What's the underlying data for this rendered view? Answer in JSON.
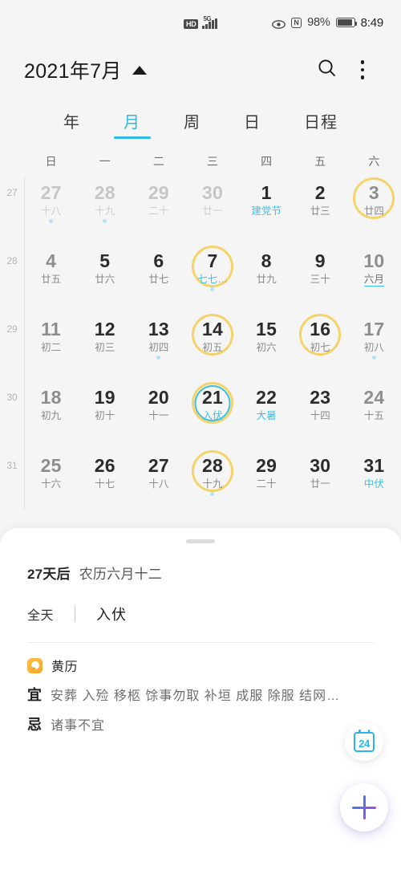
{
  "status_bar": {
    "hd_label": "HD",
    "network_label": "5G",
    "signal_icon": "signal-bars-icon",
    "eye_icon": "eye-icon",
    "nfc_label": "N",
    "battery_percent": "98%",
    "battery_icon": "battery-icon",
    "time": "8:49"
  },
  "header": {
    "title": "2021年7月",
    "caret_icon": "triangle-up-icon",
    "search_icon": "search-icon",
    "overflow_icon": "more-vertical-icon"
  },
  "view_tabs": [
    {
      "label": "年",
      "active": false
    },
    {
      "label": "月",
      "active": true
    },
    {
      "label": "周",
      "active": false
    },
    {
      "label": "日",
      "active": false
    },
    {
      "label": "日程",
      "active": false
    }
  ],
  "weekday_headers": [
    "日",
    "一",
    "二",
    "三",
    "四",
    "五",
    "六"
  ],
  "weeks": [
    {
      "number": "27",
      "days": [
        {
          "num": "27",
          "sub": "十八",
          "style": "muted",
          "ring": false,
          "dot": true
        },
        {
          "num": "28",
          "sub": "十九",
          "style": "muted",
          "ring": false,
          "dot": true
        },
        {
          "num": "29",
          "sub": "二十",
          "style": "muted",
          "ring": false,
          "dot": false
        },
        {
          "num": "30",
          "sub": "廿一",
          "style": "muted",
          "ring": false,
          "dot": false
        },
        {
          "num": "1",
          "sub": "建党节",
          "style": "accent",
          "ring": false,
          "dot": false
        },
        {
          "num": "2",
          "sub": "廿三",
          "style": "normal",
          "ring": false,
          "dot": false
        },
        {
          "num": "3",
          "sub": "廿四",
          "style": "weekend",
          "ring": true,
          "dot": false
        }
      ]
    },
    {
      "number": "28",
      "days": [
        {
          "num": "4",
          "sub": "廿五",
          "style": "weekend",
          "ring": false,
          "dot": false
        },
        {
          "num": "5",
          "sub": "廿六",
          "style": "normal",
          "ring": false,
          "dot": false
        },
        {
          "num": "6",
          "sub": "廿七",
          "style": "normal",
          "ring": false,
          "dot": false
        },
        {
          "num": "7",
          "sub": "七七…",
          "style": "accent",
          "ring": true,
          "dot": true
        },
        {
          "num": "8",
          "sub": "廿九",
          "style": "normal",
          "ring": false,
          "dot": false
        },
        {
          "num": "9",
          "sub": "三十",
          "style": "normal",
          "ring": false,
          "dot": false
        },
        {
          "num": "10",
          "sub": "六月",
          "style": "underline",
          "ring": false,
          "dot": false
        }
      ]
    },
    {
      "number": "29",
      "days": [
        {
          "num": "11",
          "sub": "初二",
          "style": "weekend",
          "ring": false,
          "dot": false
        },
        {
          "num": "12",
          "sub": "初三",
          "style": "normal",
          "ring": false,
          "dot": false
        },
        {
          "num": "13",
          "sub": "初四",
          "style": "normal",
          "ring": false,
          "dot": true
        },
        {
          "num": "14",
          "sub": "初五",
          "style": "normal",
          "ring": true,
          "dot": false
        },
        {
          "num": "15",
          "sub": "初六",
          "style": "normal",
          "ring": false,
          "dot": false
        },
        {
          "num": "16",
          "sub": "初七",
          "style": "normal",
          "ring": true,
          "dot": false
        },
        {
          "num": "17",
          "sub": "初八",
          "style": "weekend",
          "ring": false,
          "dot": true
        }
      ]
    },
    {
      "number": "30",
      "days": [
        {
          "num": "18",
          "sub": "初九",
          "style": "weekend",
          "ring": false,
          "dot": false
        },
        {
          "num": "19",
          "sub": "初十",
          "style": "normal",
          "ring": false,
          "dot": false
        },
        {
          "num": "20",
          "sub": "十一",
          "style": "normal",
          "ring": false,
          "dot": false
        },
        {
          "num": "21",
          "sub": "入伏",
          "style": "accent",
          "ring": true,
          "selected": true,
          "dot": false
        },
        {
          "num": "22",
          "sub": "大暑",
          "style": "accent",
          "ring": false,
          "dot": false
        },
        {
          "num": "23",
          "sub": "十四",
          "style": "normal",
          "ring": false,
          "dot": false
        },
        {
          "num": "24",
          "sub": "十五",
          "style": "weekend",
          "ring": false,
          "dot": false
        }
      ]
    },
    {
      "number": "31",
      "days": [
        {
          "num": "25",
          "sub": "十六",
          "style": "weekend",
          "ring": false,
          "dot": false
        },
        {
          "num": "26",
          "sub": "十七",
          "style": "normal",
          "ring": false,
          "dot": false
        },
        {
          "num": "27",
          "sub": "十八",
          "style": "normal",
          "ring": false,
          "dot": false
        },
        {
          "num": "28",
          "sub": "十九",
          "style": "normal",
          "ring": true,
          "dot": true
        },
        {
          "num": "29",
          "sub": "二十",
          "style": "normal",
          "ring": false,
          "dot": false
        },
        {
          "num": "30",
          "sub": "廿一",
          "style": "normal",
          "ring": false,
          "dot": false
        },
        {
          "num": "31",
          "sub": "中伏",
          "style": "accent",
          "ring": false,
          "dot": false
        }
      ]
    }
  ],
  "detail_sheet": {
    "handle_icon": "drag-handle-icon",
    "days_until": "27天后",
    "lunar_date": "农历六月十二",
    "event": {
      "allday_label": "全天",
      "title": "入伏"
    },
    "almanac": {
      "icon": "yinyang-icon",
      "title": "黄历",
      "good_key": "宜",
      "good_value": "安葬 入殓 移柩 馀事勿取 补垣 成服 除服 结网…",
      "bad_key": "忌",
      "bad_value": "诸事不宜"
    }
  },
  "fabs": {
    "today_icon": "calendar-24-icon",
    "today_label": "24",
    "add_icon": "plus-icon"
  },
  "colors": {
    "accent_cyan": "#3ec1e0",
    "marker_yellow": "#f4d36a",
    "almanac_orange": "#f5a623",
    "background": "#f5f5f5"
  }
}
